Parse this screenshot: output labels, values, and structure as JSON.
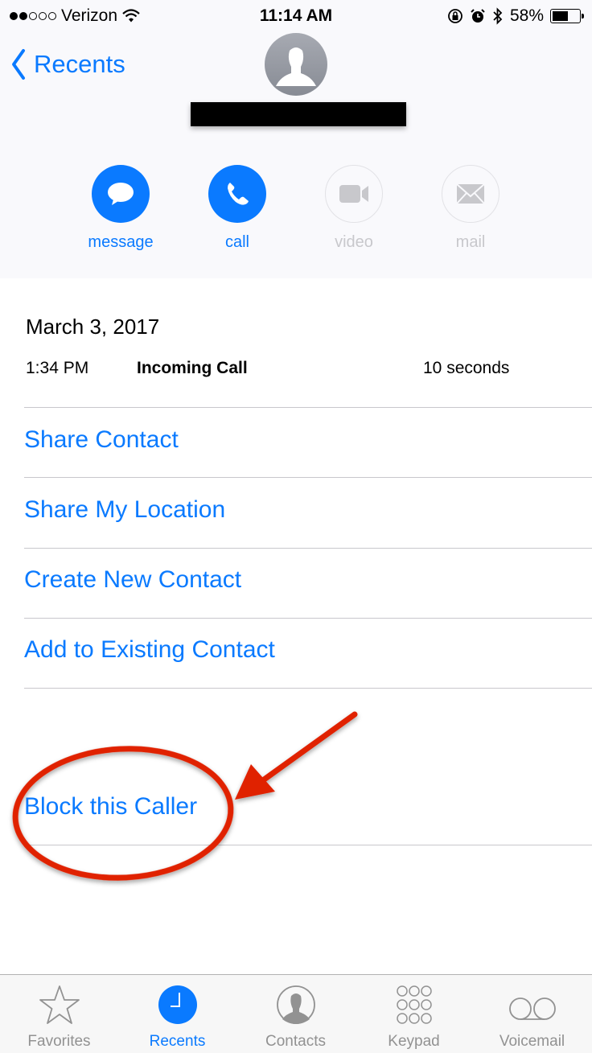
{
  "status_bar": {
    "signal_filled": 2,
    "signal_total": 5,
    "carrier": "Verizon",
    "time": "11:14 AM",
    "battery_percent_label": "58%",
    "battery_level": 0.58,
    "icons": [
      "wifi-icon",
      "orientation-lock-icon",
      "alarm-icon",
      "bluetooth-icon",
      "battery-icon"
    ]
  },
  "nav": {
    "back_label": "Recents",
    "contact_name_redacted": true
  },
  "actions": [
    {
      "label": "message",
      "icon": "message-bubble-icon",
      "enabled": true
    },
    {
      "label": "call",
      "icon": "phone-icon",
      "enabled": true
    },
    {
      "label": "video",
      "icon": "video-camera-icon",
      "enabled": false
    },
    {
      "label": "mail",
      "icon": "envelope-icon",
      "enabled": false
    }
  ],
  "call_log": {
    "date": "March 3, 2017",
    "entries": [
      {
        "time": "1:34 PM",
        "type": "Incoming Call",
        "duration": "10 seconds"
      }
    ]
  },
  "menu": [
    {
      "label": "Share Contact"
    },
    {
      "label": "Share My Location"
    },
    {
      "label": "Create New Contact"
    },
    {
      "label": "Add to Existing Contact"
    }
  ],
  "block": {
    "label": "Block this Caller",
    "annotation": "red-circle-and-arrow-highlight"
  },
  "tab_bar": {
    "active": "Recents",
    "tabs": [
      {
        "label": "Favorites",
        "icon": "star-icon"
      },
      {
        "label": "Recents",
        "icon": "clock-icon"
      },
      {
        "label": "Contacts",
        "icon": "contact-silhouette-icon"
      },
      {
        "label": "Keypad",
        "icon": "keypad-icon"
      },
      {
        "label": "Voicemail",
        "icon": "voicemail-icon"
      }
    ]
  },
  "colors": {
    "accent": "#0a7aff",
    "annotation_red": "#e02200",
    "disabled": "#c8c8cc"
  }
}
